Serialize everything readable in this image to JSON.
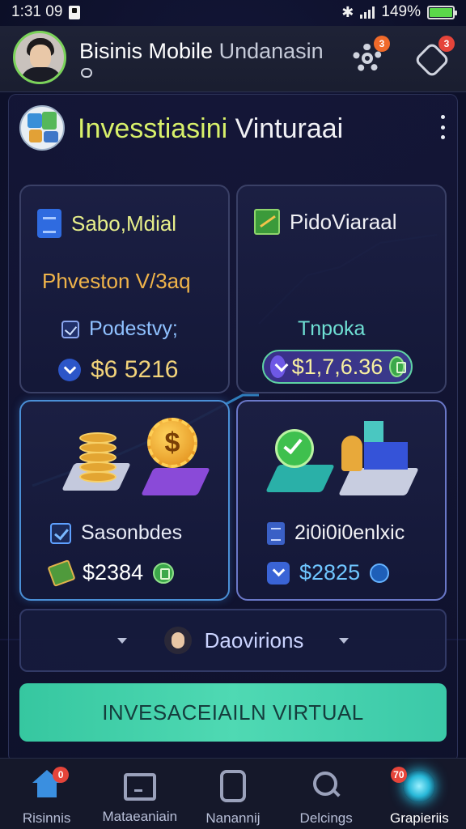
{
  "status_bar": {
    "time": "1:31 09",
    "battery": "149%"
  },
  "header": {
    "title_main": "Bisinis Mobile",
    "title_sub": "Undanasin",
    "settings_badge": "3",
    "shield_badge": "3"
  },
  "panel": {
    "title_highlight": "Invesstiasini",
    "title_rest": " Vinturaai"
  },
  "cards": [
    {
      "label": "Sabo,Mdial",
      "subtitle": "Phveston V/3aq",
      "row1": "Podestvy;",
      "amount": "$6 5216"
    },
    {
      "label": "PidoViaraal",
      "row1": "Tnpoka",
      "amount": "$1,7,6.36"
    },
    {
      "row1": "Sasonbdes",
      "amount": "$2384"
    },
    {
      "row1": "2i0i0i0enlxic",
      "amount": "$2825"
    }
  ],
  "dropdown": {
    "label": "Daovirions"
  },
  "cta": {
    "label": "INVESACEIAILN VIRTUAL"
  },
  "bottom_nav": [
    {
      "label": "Risinnis",
      "badge": "0"
    },
    {
      "label": "Mataeaniain"
    },
    {
      "label": "Nanannij"
    },
    {
      "label": "Delcings"
    },
    {
      "label": "Grapieriis",
      "badge": "70"
    }
  ],
  "colors": {
    "accent": "#4fd9b3",
    "title_highlight": "#d8f06a",
    "badge": "#e5443a",
    "background": "#111433"
  }
}
